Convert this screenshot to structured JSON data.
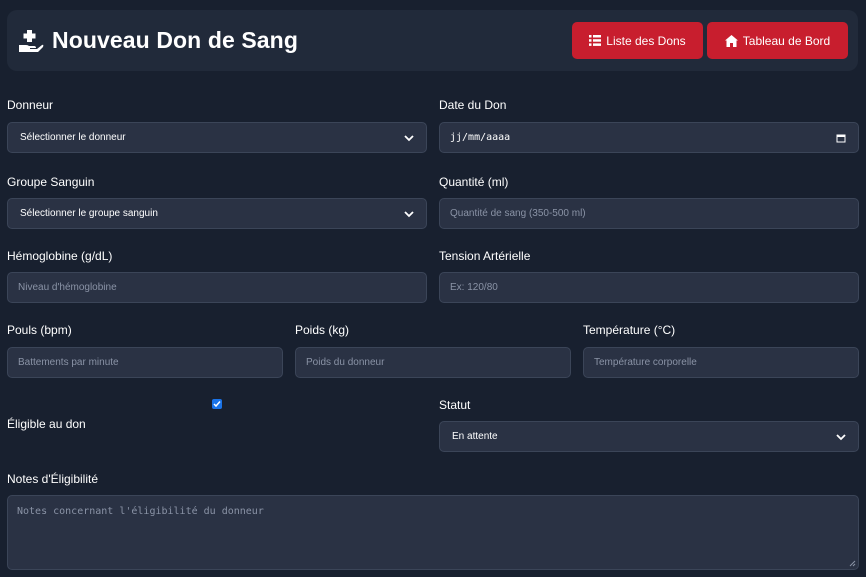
{
  "header": {
    "title": "Nouveau Don de Sang",
    "icon": "hand-holding-medical-icon",
    "buttons": [
      {
        "label": "Liste des Dons",
        "icon": "list-icon"
      },
      {
        "label": "Tableau de Bord",
        "icon": "home-icon"
      }
    ]
  },
  "form": {
    "donneur": {
      "label": "Donneur",
      "value": "Sélectionner le donneur"
    },
    "date_don": {
      "label": "Date du Don",
      "value": "jj/mm/aaaa"
    },
    "groupe_sanguin": {
      "label": "Groupe Sanguin",
      "value": "Sélectionner le groupe sanguin"
    },
    "quantite": {
      "label": "Quantité (ml)",
      "placeholder": "Quantité de sang (350-500 ml)"
    },
    "hemoglobine": {
      "label": "Hémoglobine (g/dL)",
      "placeholder": "Niveau d'hémoglobine"
    },
    "tension": {
      "label": "Tension Artérielle",
      "placeholder": "Ex: 120/80"
    },
    "pouls": {
      "label": "Pouls (bpm)",
      "placeholder": "Battements par minute"
    },
    "poids": {
      "label": "Poids (kg)",
      "placeholder": "Poids du donneur"
    },
    "temperature": {
      "label": "Température (°C)",
      "placeholder": "Température corporelle"
    },
    "eligible": {
      "label": "Éligible au don",
      "checked": true
    },
    "statut": {
      "label": "Statut",
      "value": "En attente"
    },
    "notes": {
      "label": "Notes d'Éligibilité",
      "placeholder": "Notes concernant l'éligibilité du donneur"
    }
  },
  "colors": {
    "background": "#18202f",
    "header_bg": "#212a3a",
    "field_bg": "#2a3244",
    "button_red": "#c81e2e",
    "checkbox_blue": "#1a73e8"
  }
}
